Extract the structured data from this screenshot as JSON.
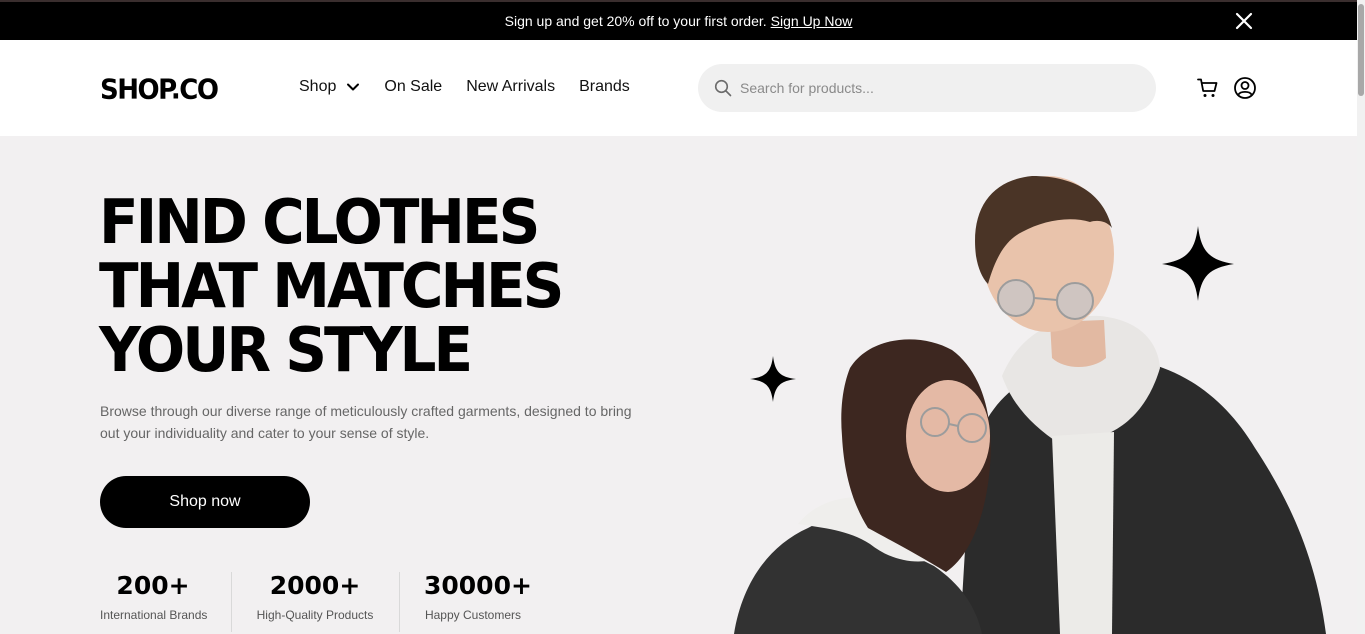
{
  "announcement": {
    "text": "Sign up and get 20% off to your first order.",
    "link_label": "Sign Up Now",
    "close_icon": "close-icon"
  },
  "header": {
    "logo": "SHOP.CO",
    "nav": [
      {
        "label": "Shop",
        "has_dropdown": true
      },
      {
        "label": "On Sale"
      },
      {
        "label": "New Arrivals"
      },
      {
        "label": "Brands"
      }
    ],
    "search": {
      "placeholder": "Search for products...",
      "value": ""
    },
    "icons": [
      "search-icon",
      "cart-icon",
      "user-icon",
      "chevron-down-icon"
    ]
  },
  "hero": {
    "title_lines": [
      "FIND CLOTHES",
      "THAT MATCHES",
      "YOUR STYLE"
    ],
    "description": "Browse through our diverse range of meticulously crafted garments, designed to bring out your individuality and cater to your sense of style.",
    "cta_label": "Shop now",
    "stats": [
      {
        "value": "200+",
        "label": "International Brands"
      },
      {
        "value": "2000+",
        "label": "High-Quality Products"
      },
      {
        "value": "30000+",
        "label": "Happy Customers"
      }
    ],
    "image_alt": "couple-photo"
  },
  "colors": {
    "announcement_bg": "#000000",
    "hero_bg": "#f2f0f1",
    "search_bg": "#f0f0f0",
    "cta_bg": "#000000",
    "text_muted": "#666666"
  }
}
